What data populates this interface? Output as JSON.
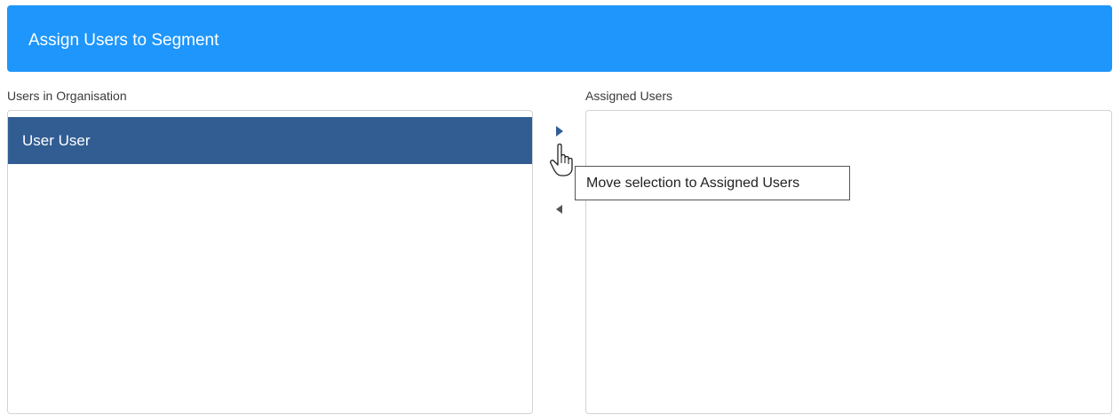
{
  "header": {
    "title": "Assign Users to Segment",
    "color": "#1e96fc"
  },
  "available": {
    "label": "Users in Organisation",
    "items": [
      {
        "label": "User User",
        "selected": true
      }
    ],
    "selected_color": "#325d93"
  },
  "assigned": {
    "label": "Assigned Users",
    "items": []
  },
  "controls": {
    "move_right_icon": "triangle-right-icon",
    "move_left_icon": "triangle-left-icon",
    "tooltip": "Move selection to Assigned Users"
  },
  "cursor": {
    "icon": "hand-pointer-icon"
  }
}
